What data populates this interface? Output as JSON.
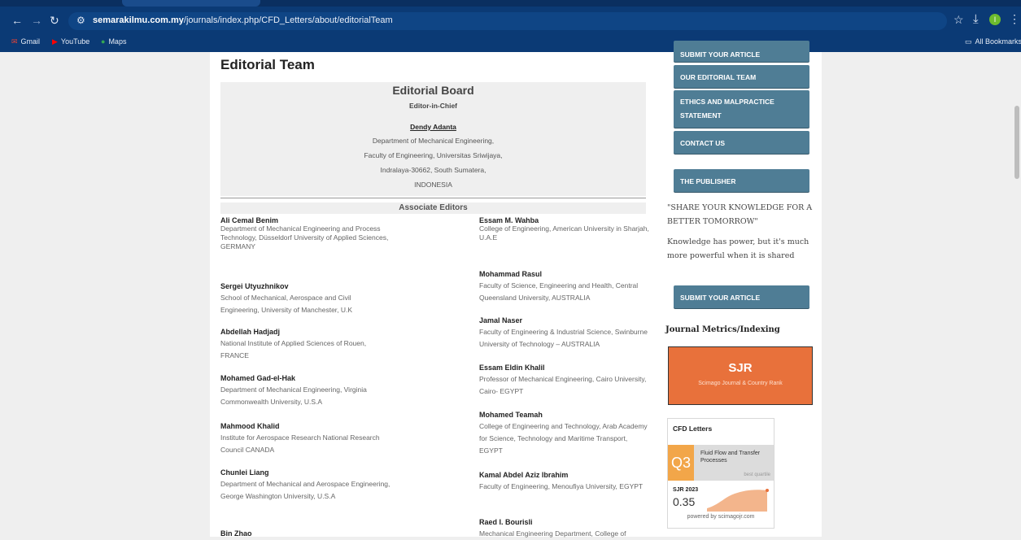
{
  "browser": {
    "url_domain": "semarakilmu.com.my",
    "url_path": "/journals/index.php/CFD_Letters/about/editorialTeam",
    "bookmarks": [
      "Gmail",
      "YouTube",
      "Maps"
    ],
    "all_bookmarks": "All Bookmarks",
    "profile_initial": "I"
  },
  "page": {
    "title": "Editorial Team",
    "board": {
      "heading": "Editorial Board",
      "role": "Editor-in-Chief",
      "name": "Dendy Adanta",
      "lines": [
        "Department of Mechanical Engineering,",
        "Faculty of Engineering, Universitas Sriwijaya,",
        "Indralaya-30662, South Sumatera,",
        "INDONESIA"
      ]
    },
    "associate_heading": "Associate Editors",
    "left_editors": [
      {
        "name": "Ali Cemal Benim",
        "affil": "Department of Mechanical Engineering and Process Technology, Düsseldorf University of Applied Sciences, GERMANY"
      },
      {
        "name": "Sergei Utyuzhnikov",
        "affil": "School of Mechanical, Aerospace and Civil Engineering, University of Manchester, U.K"
      },
      {
        "name": "Abdellah Hadjadj",
        "affil": "National Institute of Applied Sciences of Rouen, FRANCE"
      },
      {
        "name": "Mohamed Gad-el-Hak",
        "affil": "Department of Mechanical Engineering, Virginia Commonwealth University, U.S.A"
      },
      {
        "name": "Mahmood Khalid",
        "affil": "Institute for Aerospace Research National Research Council CANADA"
      },
      {
        "name": "Chunlei Liang",
        "affil": "Department of Mechanical and Aerospace Engineering, George Washington University, U.S.A"
      },
      {
        "name": "Bin Zhao",
        "affil": ""
      }
    ],
    "right_editors": [
      {
        "name": "Essam M. Wahba",
        "affil": "College of Engineering, American University in Sharjah, U.A.E"
      },
      {
        "name": "Mohammad Rasul",
        "affil": "Faculty of Science, Engineering and Health, Central Queensland University, AUSTRALIA"
      },
      {
        "name": "Jamal Naser",
        "affil": "Faculty of Engineering & Industrial Science, Swinburne University of Technology – AUSTRALIA"
      },
      {
        "name": "Essam Eldin Khalil",
        "affil": "Professor of Mechanical Engineering, Cairo University, Cairo- EGYPT"
      },
      {
        "name": "Mohamed Teamah",
        "affil": "College of Engineering and Technology, Arab Academy for Science, Technology and Maritime Transport, EGYPT"
      },
      {
        "name": "Kamal Abdel Aziz Ibrahim",
        "affil": "Faculty of Engineering, Menoufiya University, EGYPT"
      },
      {
        "name": "Raed I. Bourisli",
        "affil": "Mechanical Engineering Department, College of"
      }
    ]
  },
  "sidebar": {
    "btn_submit_top": "SUBMIT YOUR ARTICLE",
    "btn_editorial": "OUR EDITORIAL TEAM",
    "btn_ethics": "ETHICS AND MALPRACTICE STATEMENT",
    "btn_contact": "CONTACT US",
    "btn_publisher": "THE PUBLISHER",
    "quote1": "\"SHARE YOUR KNOWLEDGE FOR A BETTER TOMORROW\"",
    "quote2": "Knowledge has power, but it's much more powerful when it is shared",
    "btn_submit": "SUBMIT YOUR ARTICLE",
    "metrics_heading": "Journal Metrics/Indexing",
    "sjr_title": "SJR",
    "sjr_sub": "Scimago Journal & Country Rank",
    "widget": {
      "journal": "CFD Letters",
      "quartile": "Q3",
      "category": "Fluid Flow and Transfer Processes",
      "best": "best quartile",
      "year_label": "SJR 2023",
      "value": "0.35",
      "powered": "powered by scimagojr.com"
    }
  }
}
